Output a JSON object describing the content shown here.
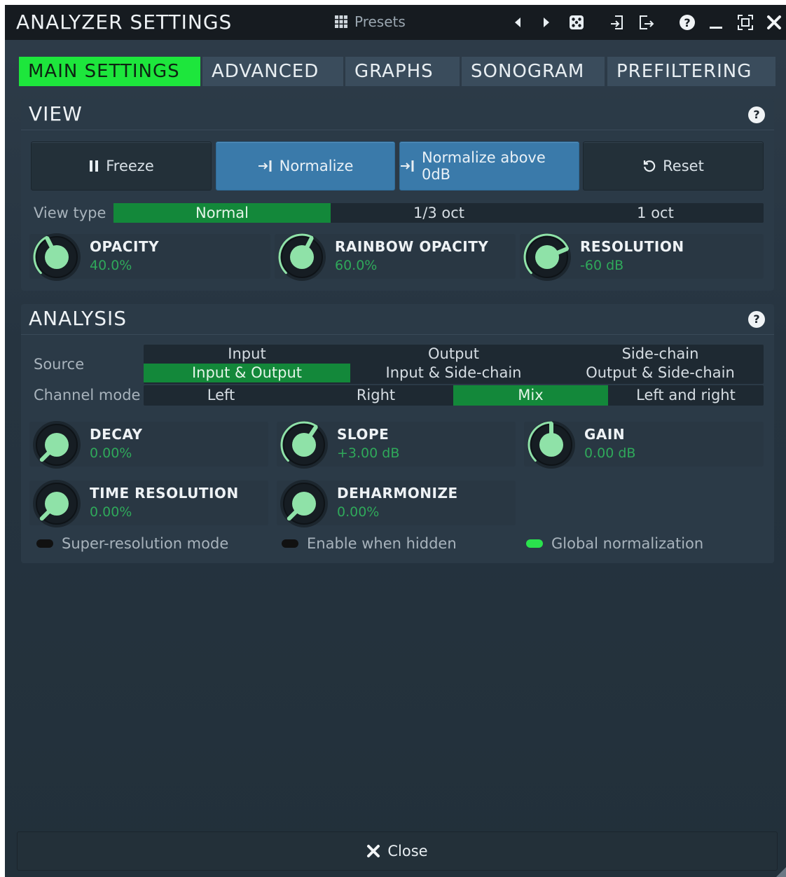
{
  "window": {
    "title": "ANALYZER SETTINGS",
    "presets_label": "Presets",
    "toolbar_icons": [
      "prev-arrow-icon",
      "next-arrow-icon",
      "random-dice-icon",
      "import-icon",
      "export-icon",
      "help-icon",
      "minimize-icon",
      "fullscreen-icon",
      "close-icon"
    ]
  },
  "tabs": [
    {
      "label": "MAIN SETTINGS",
      "active": true
    },
    {
      "label": "ADVANCED",
      "active": false
    },
    {
      "label": "GRAPHS",
      "active": false
    },
    {
      "label": "SONOGRAM",
      "active": false
    },
    {
      "label": "PREFILTERING",
      "active": false
    }
  ],
  "view": {
    "title": "VIEW",
    "help": "?",
    "buttons": [
      {
        "label": "Freeze",
        "icon": "pause-icon",
        "on": false
      },
      {
        "label": "Normalize",
        "icon": "normalize-icon",
        "on": true
      },
      {
        "label": "Normalize above 0dB",
        "icon": "normalize-icon",
        "on": true
      },
      {
        "label": "Reset",
        "icon": "reset-icon",
        "on": false
      }
    ],
    "view_type": {
      "label": "View type",
      "options": [
        "Normal",
        "1/3 oct",
        "1 oct"
      ],
      "selected": "Normal"
    },
    "knobs": [
      {
        "name": "OPACITY",
        "value": "40.0%",
        "level": 0.4
      },
      {
        "name": "RAINBOW OPACITY",
        "value": "60.0%",
        "level": 0.6
      },
      {
        "name": "RESOLUTION",
        "value": "-60 dB",
        "level": 0.75
      }
    ]
  },
  "analysis": {
    "title": "ANALYSIS",
    "help": "?",
    "source": {
      "label": "Source",
      "options": [
        "Input",
        "Output",
        "Side-chain",
        "Input & Output",
        "Input & Side-chain",
        "Output & Side-chain"
      ],
      "selected": "Input & Output"
    },
    "channel_mode": {
      "label": "Channel mode",
      "options": [
        "Left",
        "Right",
        "Mix",
        "Left and right"
      ],
      "selected": "Mix"
    },
    "knobs": [
      {
        "name": "DECAY",
        "value": "0.00%",
        "level": 0.0
      },
      {
        "name": "SLOPE",
        "value": "+3.00 dB",
        "level": 0.625
      },
      {
        "name": "GAIN",
        "value": "0.00 dB",
        "level": 0.5
      },
      {
        "name": "TIME RESOLUTION",
        "value": "0.00%",
        "level": 0.0
      },
      {
        "name": "DEHARMONIZE",
        "value": "0.00%",
        "level": 0.0
      }
    ],
    "switches": [
      {
        "label": "Super-resolution mode",
        "on": false
      },
      {
        "label": "Enable when hidden",
        "on": false
      },
      {
        "label": "Global normalization",
        "on": true
      }
    ]
  },
  "footer": {
    "close_label": "Close"
  },
  "colors": {
    "accent_green": "#1de63c",
    "selected_green": "#13883a",
    "value_green": "#2fa85a",
    "knob_face": "#8fe2a8",
    "button_blue": "#3a7aaa"
  }
}
